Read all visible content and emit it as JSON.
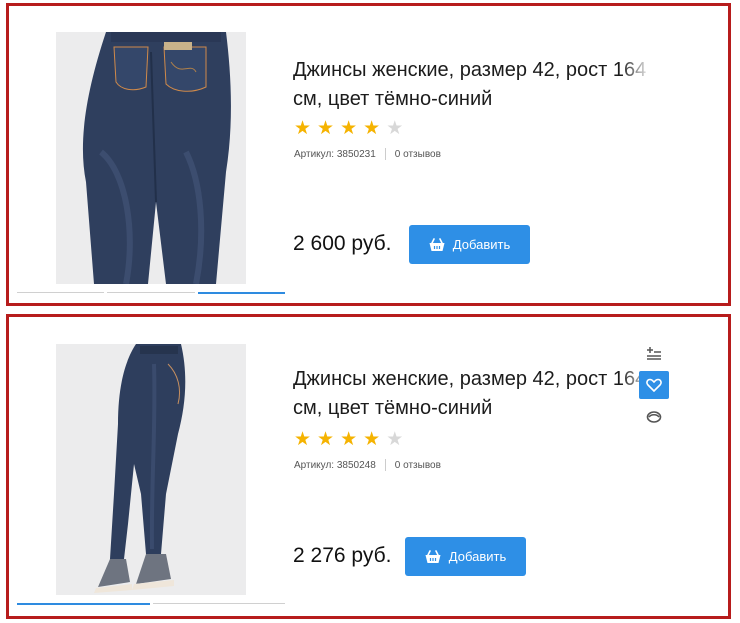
{
  "products": [
    {
      "title": "Джинсы женские, размер 42, рост 164 см, цвет тёмно-синий",
      "rating": 4,
      "article_label": "Артикул: 3850231",
      "reviews": "0 отзывов",
      "price": "2 600 руб.",
      "add_label": "Добавить",
      "image_icon": "jeans-back-photo"
    },
    {
      "title": "Джинсы женские, размер 42, рост 164 см, цвет тёмно-синий",
      "rating": 4,
      "article_label": "Артикул: 3850248",
      "reviews": "0 отзывов",
      "price": "2 276 руб.",
      "add_label": "Добавить",
      "image_icon": "jeans-side-photo",
      "side_icons": [
        "compare-icon",
        "heart-icon",
        "eye-icon"
      ]
    }
  ],
  "colors": {
    "accent": "#2e8fe6",
    "star": "#f5b301",
    "border": "#b71c1c"
  }
}
